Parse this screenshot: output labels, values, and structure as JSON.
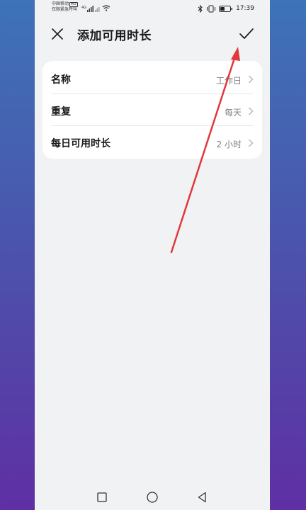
{
  "status_bar": {
    "carrier_line1": "中国移动",
    "carrier_badge": "HD",
    "carrier_line2": "仅限紧急呼叫",
    "network_type": "4G",
    "time": "17:39"
  },
  "header": {
    "title": "添加可用时长",
    "close_icon": "close-icon",
    "confirm_icon": "check-icon"
  },
  "settings": [
    {
      "label": "名称",
      "value": "工作日"
    },
    {
      "label": "重复",
      "value": "每天"
    },
    {
      "label": "每日可用时长",
      "value": "2 小时"
    }
  ],
  "colors": {
    "background": "#f1f2f4",
    "card": "#ffffff",
    "annotation_arrow": "#e0383b"
  }
}
